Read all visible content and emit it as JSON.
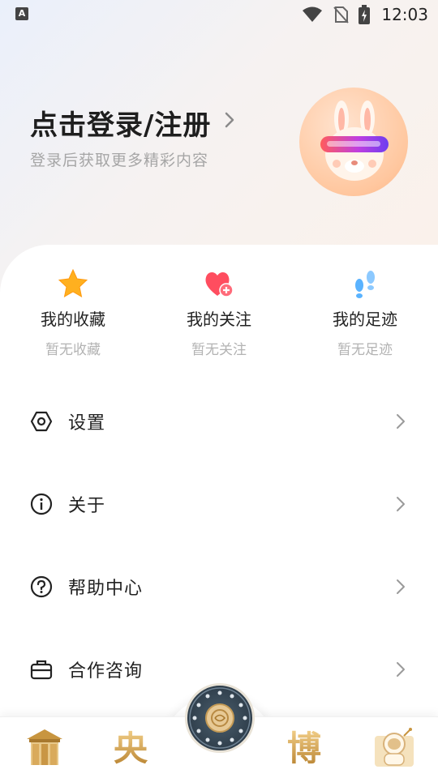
{
  "status_bar": {
    "app_badge": "A",
    "time": "12:03"
  },
  "header": {
    "login_title": "点击登录/注册",
    "login_subtitle": "登录后获取更多精彩内容"
  },
  "quick_actions": [
    {
      "label": "我的收藏",
      "sub": "暂无收藏",
      "icon": "star-icon"
    },
    {
      "label": "我的关注",
      "sub": "暂无关注",
      "icon": "heart-plus-icon"
    },
    {
      "label": "我的足迹",
      "sub": "暂无足迹",
      "icon": "footprints-icon"
    }
  ],
  "menu": [
    {
      "label": "设置",
      "icon": "settings-hex-icon"
    },
    {
      "label": "关于",
      "icon": "info-icon"
    },
    {
      "label": "帮助中心",
      "icon": "help-icon"
    },
    {
      "label": "合作咨询",
      "icon": "briefcase-icon"
    }
  ],
  "bottom_nav": {
    "items": [
      "home-pavilion-icon",
      "yang-character-icon",
      "center-dial-icon",
      "bo-character-icon",
      "astronaut-icon"
    ],
    "char_yang": "央",
    "char_bo": "博"
  },
  "colors": {
    "accent_gold": "#c8953f",
    "star": "#ffb01f",
    "heart": "#ff4d5f",
    "footprints": "#5ab3ff"
  }
}
